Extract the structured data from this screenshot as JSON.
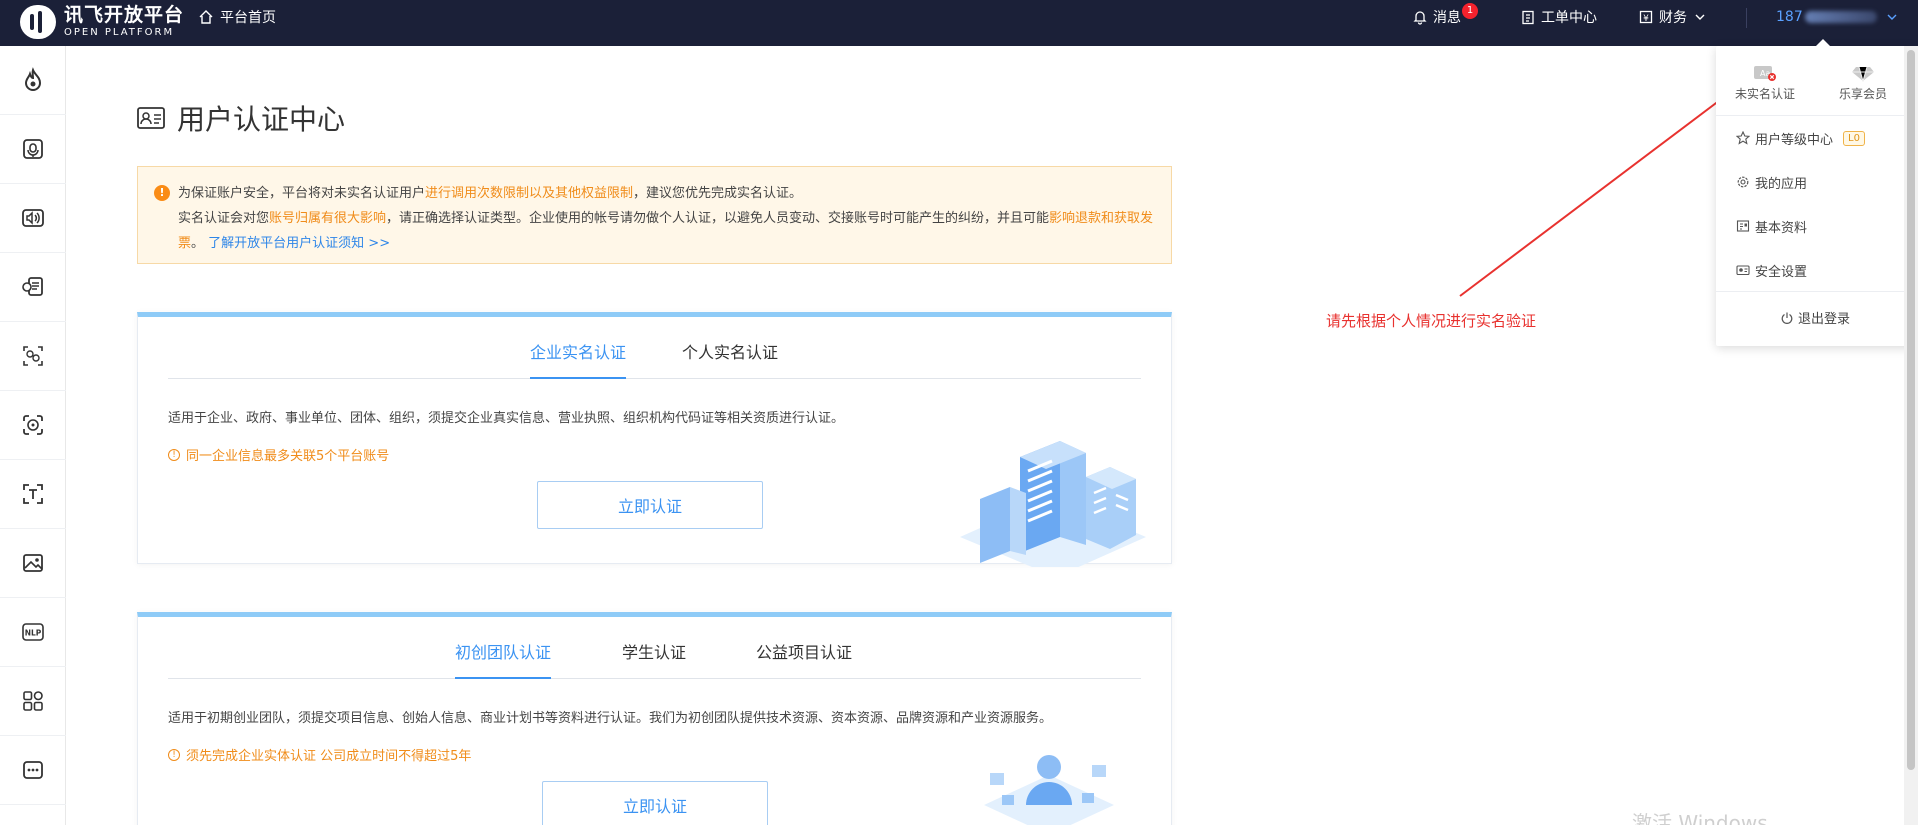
{
  "topbar": {
    "logo_main": "讯飞开放平台",
    "logo_sub": "OPEN PLATFORM",
    "home": "平台首页",
    "messages": "消息",
    "messages_count": "1",
    "tickets": "工单中心",
    "finance": "财务",
    "user_prefix": "187"
  },
  "sidebar": {
    "icons": [
      "flame-icon",
      "voice-recognition-icon",
      "speech-synthesis-icon",
      "voice-chat-icon",
      "face-compare-icon",
      "face-detect-icon",
      "text-ocr-icon",
      "image-icon",
      "nlp-icon",
      "apps-grid-icon",
      "more-icon"
    ]
  },
  "page": {
    "title": "用户认证中心"
  },
  "notice": {
    "line1_a": "为保证账户安全，平台将对未实名认证用户",
    "line1_hl": "进行调用次数限制以及其他权益限制",
    "line1_b": "，建议您优先完成实名认证。",
    "line2_a": "实名认证会对您",
    "line2_hl1": "账号归属有很大影响",
    "line2_b": "，请正确选择认证类型。企业使用的帐号请勿做个人认证，以避免人员变动、交接账号时可能产生的纠纷，并且可能",
    "line2_hl2": "影响退款和获取发票",
    "line2_c": "。",
    "link": "了解开放平台用户认证须知 >>"
  },
  "card1": {
    "tabs": [
      "企业实名认证",
      "个人实名认证"
    ],
    "desc": "适用于企业、政府、事业单位、团体、组织，须提交企业真实信息、营业执照、组织机构代码证等相关资质进行认证。",
    "warn": "同一企业信息最多关联5个平台账号",
    "button": "立即认证"
  },
  "card2": {
    "tabs": [
      "初创团队认证",
      "学生认证",
      "公益项目认证"
    ],
    "desc": "适用于初期创业团队，须提交项目信息、创始人信息、商业计划书等资料进行认证。我们为初创团队提供技术资源、资本资源、品牌资源和产业资源服务。",
    "warn": "须先完成企业实体认证 公司成立时间不得超过5年",
    "button": "立即认证"
  },
  "annotation": {
    "text": "请先根据个人情况进行实名验证",
    "color": "#e8322f"
  },
  "dropdown": {
    "unverified": "未实名认证",
    "member": "乐享会员",
    "level_center": "用户等级中心",
    "level_tag": "L0",
    "my_apps": "我的应用",
    "basic_info": "基本资料",
    "security": "安全设置",
    "logout": "退出登录"
  },
  "watermark": "激活 Windows",
  "colors": {
    "topbar": "#1b2038",
    "accent": "#3b93f2",
    "warn": "#f08c1a"
  }
}
